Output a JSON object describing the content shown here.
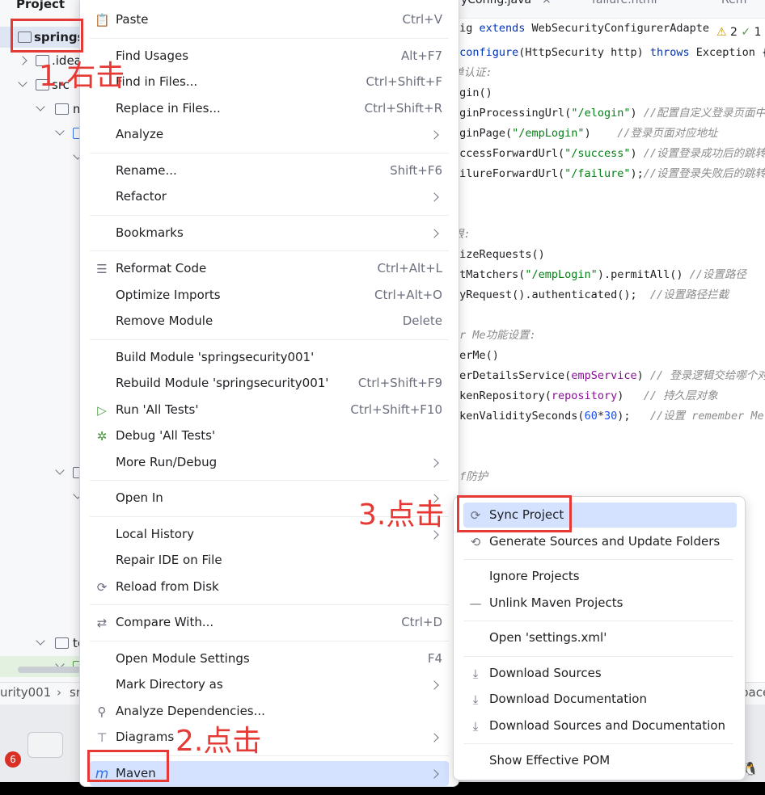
{
  "project_panel": {
    "title": "Project",
    "root": "springse",
    "rows": [
      ".idea",
      "src",
      "m",
      "te"
    ],
    "status_crumbs": [
      "urity001",
      "sr"
    ]
  },
  "editor": {
    "tabs": [
      "yConfig.java",
      "failure.html",
      "Rem"
    ],
    "inspections": {
      "warnings": "2",
      "other": "1"
    },
    "status_right": "pace",
    "lines": [
      {
        "parts": [
          [
            "fig ",
            "t"
          ],
          [
            "extends",
            "kw"
          ],
          [
            " WebSecurityConfigurerAdapte",
            "t"
          ]
        ]
      },
      {
        "parts": [
          [
            " configure",
            "kw"
          ],
          [
            "(HttpSecurity http) ",
            "t"
          ],
          [
            "throws",
            "kw"
          ],
          [
            " Exception {",
            "t"
          ]
        ]
      },
      {
        "parts": [
          [
            "单认证:",
            "cm"
          ]
        ]
      },
      {
        "parts": [
          [
            "ogin()",
            "t"
          ]
        ]
      },
      {
        "parts": [
          [
            "oginProcessingUrl(",
            "t"
          ],
          [
            "\"/elogin\"",
            "str"
          ],
          [
            ") ",
            "t"
          ],
          [
            "//配置自定义登录页面中",
            "cm"
          ]
        ]
      },
      {
        "parts": [
          [
            "oginPage(",
            "t"
          ],
          [
            "\"/empLogin\"",
            "str"
          ],
          [
            ")    ",
            "t"
          ],
          [
            "//登录页面对应地址",
            "cm"
          ]
        ]
      },
      {
        "parts": [
          [
            "uccessForwardUrl(",
            "t"
          ],
          [
            "\"/success\"",
            "str"
          ],
          [
            ") ",
            "t"
          ],
          [
            "//设置登录成功后的跳转",
            "cm"
          ]
        ]
      },
      {
        "parts": [
          [
            "ailureForwardUrl(",
            "t"
          ],
          [
            "\"/failure\"",
            "str"
          ],
          [
            ");",
            "t"
          ],
          [
            "//设置登录失败后的跳转",
            "cm"
          ]
        ]
      },
      {
        "parts": []
      },
      {
        "parts": []
      },
      {
        "parts": [
          [
            "限:",
            "cm"
          ]
        ]
      },
      {
        "parts": [
          [
            "rizeRequests()",
            "t"
          ]
        ]
      },
      {
        "parts": [
          [
            "ntMatchers(",
            "t"
          ],
          [
            "\"/empLogin\"",
            "str"
          ],
          [
            ").permitAll() ",
            "t"
          ],
          [
            "//设置路径",
            "cm"
          ]
        ]
      },
      {
        "parts": [
          [
            "nyRequest().authenticated();  ",
            "t"
          ],
          [
            "//设置路径拦截",
            "cm"
          ]
        ]
      },
      {
        "parts": []
      },
      {
        "parts": [
          [
            "er Me功能设置:",
            "cm"
          ]
        ]
      },
      {
        "parts": [
          [
            "berMe()",
            "t"
          ]
        ]
      },
      {
        "parts": [
          [
            "serDetailsService(",
            "t"
          ],
          [
            "empService",
            "fld"
          ],
          [
            ") ",
            "t"
          ],
          [
            "// 登录逻辑交给哪个对",
            "cm"
          ]
        ]
      },
      {
        "parts": [
          [
            "okenRepository(",
            "t"
          ],
          [
            "repository",
            "fld"
          ],
          [
            ")   ",
            "t"
          ],
          [
            "// 持久层对象",
            "cm"
          ]
        ]
      },
      {
        "parts": [
          [
            "okenValiditySeconds(",
            "t"
          ],
          [
            "60",
            "num"
          ],
          [
            "*",
            "t"
          ],
          [
            "30",
            "num"
          ],
          [
            ");   ",
            "t"
          ],
          [
            "//设置 remember Me",
            "cm"
          ]
        ]
      },
      {
        "parts": []
      },
      {
        "parts": []
      },
      {
        "parts": [
          [
            "rf防护",
            "cm"
          ]
        ]
      }
    ]
  },
  "context_menu": {
    "items": [
      {
        "label": "Paste",
        "shortcut": "Ctrl+V",
        "icon": "clipboard-icon"
      },
      {
        "sep": true
      },
      {
        "label": "Find Usages",
        "shortcut": "Alt+F7"
      },
      {
        "label": "Find in Files...",
        "shortcut": "Ctrl+Shift+F"
      },
      {
        "label": "Replace in Files...",
        "shortcut": "Ctrl+Shift+R"
      },
      {
        "label": "Analyze",
        "submenu": true
      },
      {
        "sep": true
      },
      {
        "label": "Rename...",
        "shortcut": "Shift+F6"
      },
      {
        "label": "Refactor",
        "submenu": true
      },
      {
        "sep": true
      },
      {
        "label": "Bookmarks",
        "submenu": true
      },
      {
        "sep": true
      },
      {
        "label": "Reformat Code",
        "shortcut": "Ctrl+Alt+L",
        "icon": "reformat-icon"
      },
      {
        "label": "Optimize Imports",
        "shortcut": "Ctrl+Alt+O"
      },
      {
        "label": "Remove Module",
        "shortcut": "Delete"
      },
      {
        "sep": true
      },
      {
        "label": "Build Module 'springsecurity001'"
      },
      {
        "label": "Rebuild Module 'springsecurity001'",
        "shortcut": "Ctrl+Shift+F9"
      },
      {
        "label": "Run 'All Tests'",
        "shortcut": "Ctrl+Shift+F10",
        "icon": "run-icon"
      },
      {
        "label": "Debug 'All Tests'",
        "icon": "debug-icon"
      },
      {
        "label": "More Run/Debug",
        "submenu": true
      },
      {
        "sep": true
      },
      {
        "label": "Open In",
        "submenu": true
      },
      {
        "sep": true
      },
      {
        "label": "Local History",
        "submenu": true
      },
      {
        "label": "Repair IDE on File"
      },
      {
        "label": "Reload from Disk",
        "icon": "reload-icon"
      },
      {
        "sep": true
      },
      {
        "label": "Compare With...",
        "shortcut": "Ctrl+D",
        "icon": "compare-icon"
      },
      {
        "sep": true
      },
      {
        "label": "Open Module Settings",
        "shortcut": "F4"
      },
      {
        "label": "Mark Directory as",
        "submenu": true
      },
      {
        "label": "Analyze Dependencies...",
        "icon": "analyze-dependencies-icon"
      },
      {
        "label": "Diagrams",
        "submenu": true,
        "icon": "diagrams-icon"
      },
      {
        "sep": true
      },
      {
        "label": "Maven",
        "submenu": true,
        "icon": "maven-icon",
        "selected": true
      }
    ]
  },
  "maven_submenu": {
    "items": [
      {
        "label": "Sync Project",
        "icon": "sync-icon",
        "selected": true
      },
      {
        "label": "Generate Sources and Update Folders",
        "icon": "generate-sources-icon"
      },
      {
        "sep": true
      },
      {
        "label": "Ignore Projects"
      },
      {
        "label": "Unlink Maven Projects",
        "icon": "unlink-icon"
      },
      {
        "sep": true
      },
      {
        "label": "Open 'settings.xml'"
      },
      {
        "sep": true
      },
      {
        "label": "Download Sources",
        "icon": "download-icon"
      },
      {
        "label": "Download Documentation",
        "icon": "download-icon"
      },
      {
        "label": "Download Sources and Documentation",
        "icon": "download-icon"
      },
      {
        "sep": true
      },
      {
        "label": "Show Effective POM"
      }
    ]
  },
  "annotations": {
    "step1": "1.右击",
    "step2": "2.点击",
    "step3": "3.点击"
  },
  "taskbar": {
    "badge": "6"
  },
  "colors": {
    "annotation": "#e53935",
    "selection": "#d4e2ff",
    "keyword": "#0033b3",
    "string": "#067d17"
  }
}
